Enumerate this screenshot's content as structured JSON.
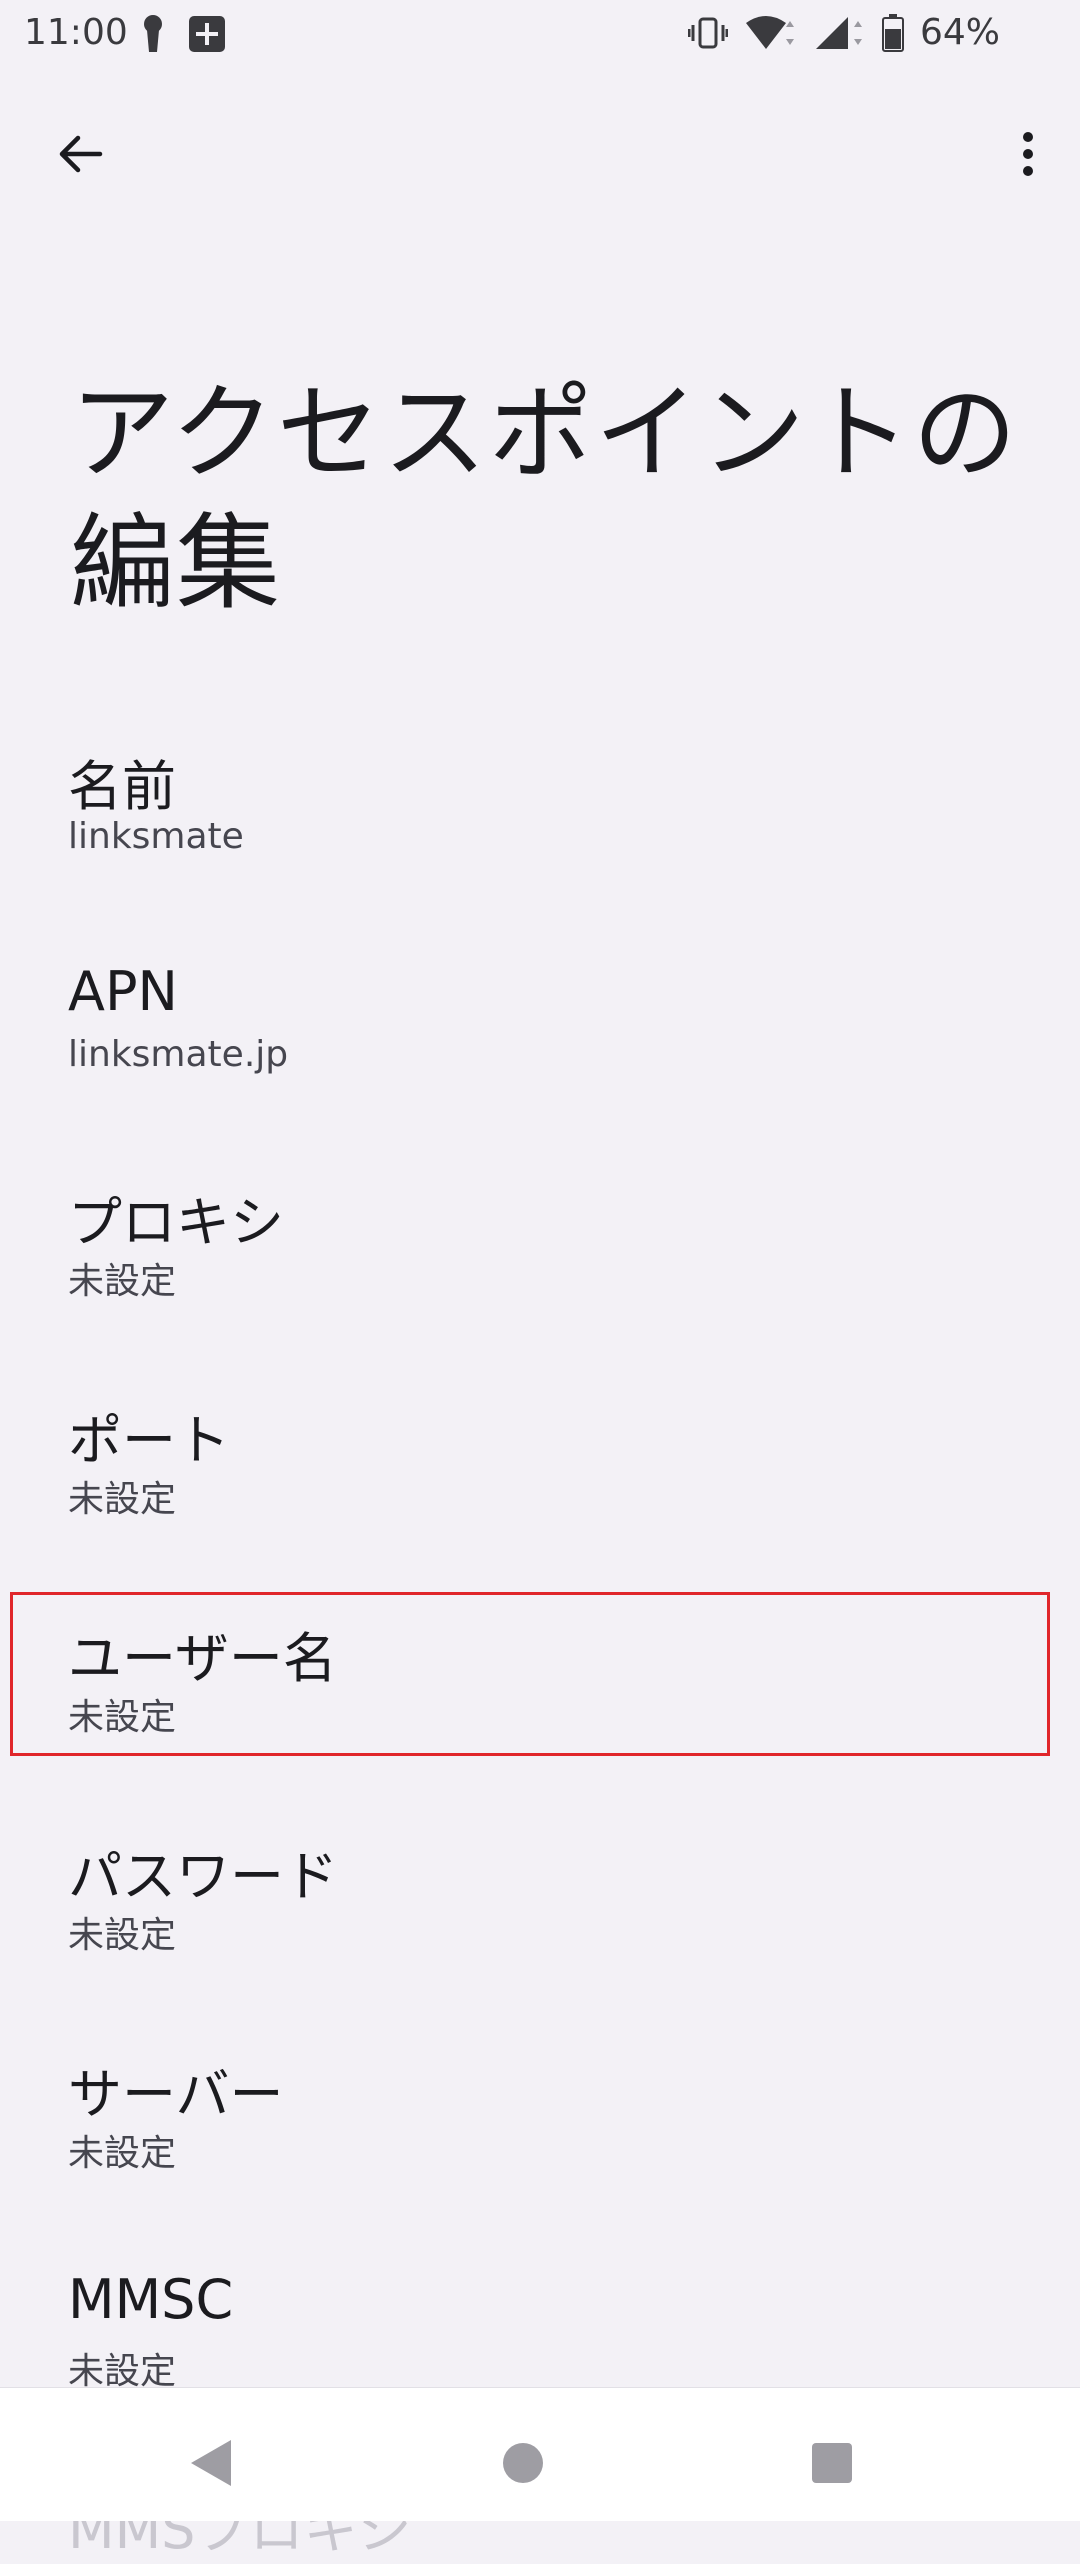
{
  "status_bar": {
    "time": "11:00",
    "battery": "64%",
    "icons": [
      "key-icon",
      "plus-box-icon",
      "vibrate-icon",
      "wifi-icon",
      "signal-icon",
      "battery-icon"
    ]
  },
  "app_bar": {
    "back_icon": "arrow-back-icon",
    "more_icon": "more-vert-icon"
  },
  "page": {
    "title_line1": "アクセスポイントの",
    "title_line2": "編集"
  },
  "preferences": [
    {
      "title": "名前",
      "summary": "linksmate"
    },
    {
      "title": "APN",
      "summary": "linksmate.jp"
    },
    {
      "title": "プロキシ",
      "summary": "未設定"
    },
    {
      "title": "ポート",
      "summary": "未設定"
    },
    {
      "title": "ユーザー名",
      "summary": "未設定"
    },
    {
      "title": "パスワード",
      "summary": "未設定"
    },
    {
      "title": "サーバー",
      "summary": "未設定"
    },
    {
      "title": "MMSC",
      "summary": "未設定"
    }
  ],
  "partially_visible_item": "MMSプロキシ",
  "nav": {
    "back": "nav-back-icon",
    "home": "nav-home-icon",
    "recents": "nav-recents-icon"
  },
  "colors": {
    "background": "#f3f1f6",
    "highlight_border": "#e0262b"
  }
}
